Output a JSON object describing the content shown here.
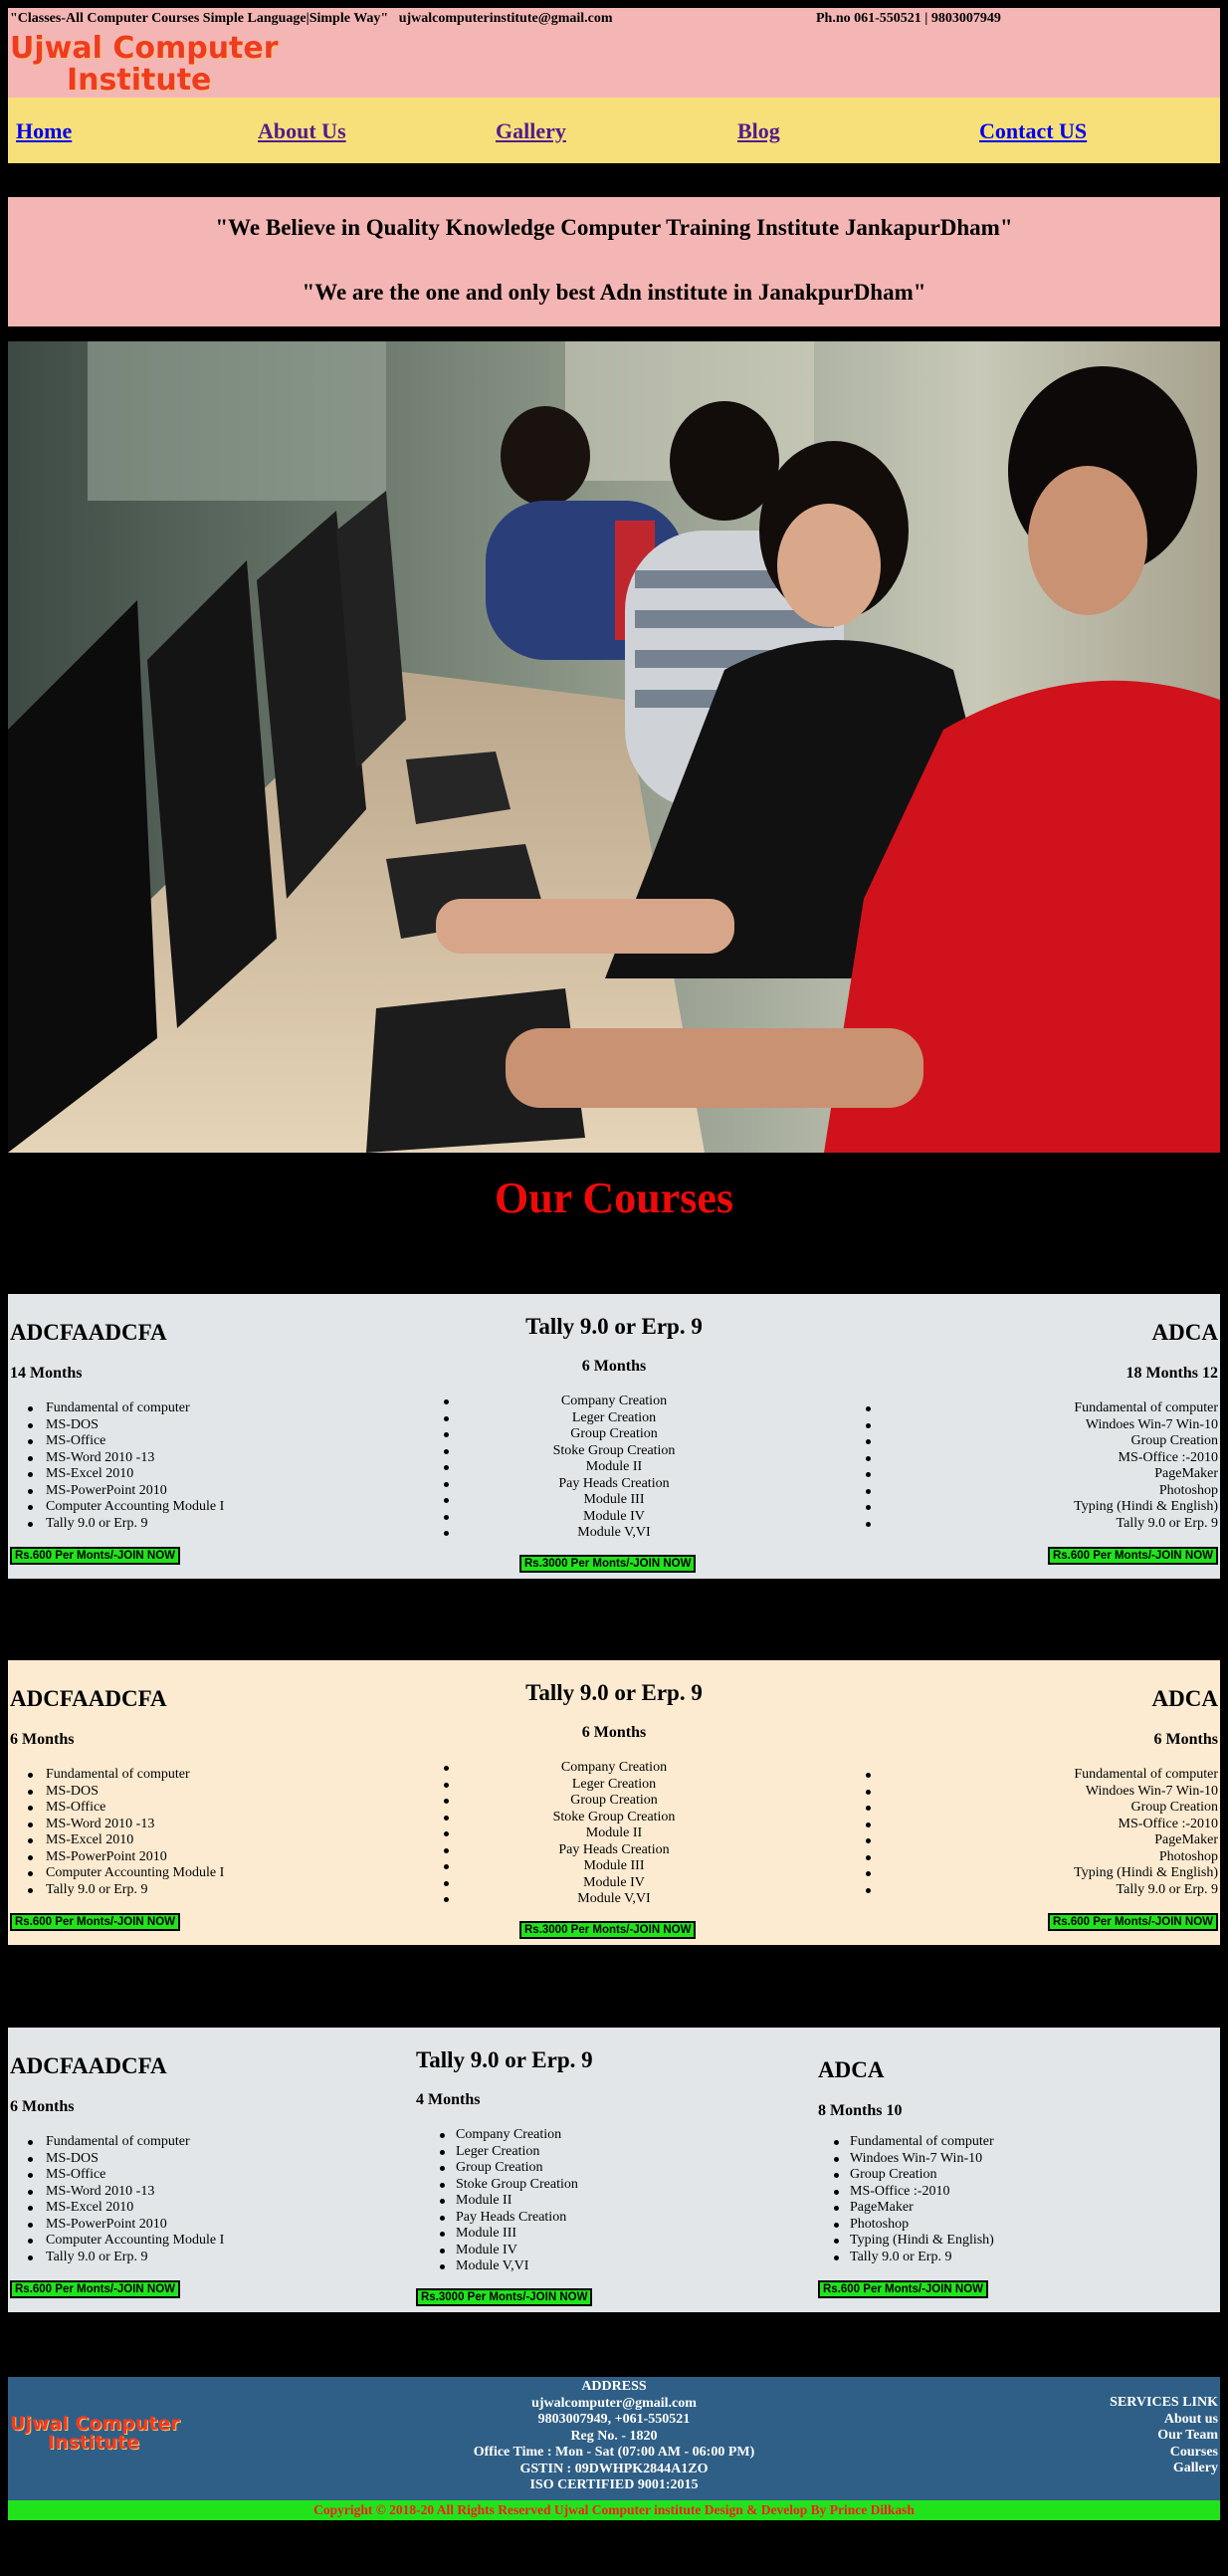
{
  "header": {
    "tagline": "\"Classes-All Computer Courses Simple Language|Simple Way\"",
    "email": "ujwalcomputerinstitute@gmail.com",
    "phone": "Ph.no 061-550521 | 9803007949",
    "logo_line1": "Ujwal Computer",
    "logo_line2": "Institute"
  },
  "nav": {
    "items": [
      {
        "label": "Home"
      },
      {
        "label": "About Us"
      },
      {
        "label": "Gallery"
      },
      {
        "label": "Blog"
      },
      {
        "label": "Contact US"
      }
    ]
  },
  "quotes": {
    "line1": "\"We Believe in Quality Knowledge Computer Training Institute JankapurDham\"",
    "line2": "\"We are the one and only best Adn institute in JanakpurDham\""
  },
  "hero": {
    "image_alt": "Students typing at computers in a classroom"
  },
  "courses_heading": "Our Courses",
  "course_rows": [
    {
      "col1": {
        "title": "ADCFAADCFA",
        "duration": "14 Months",
        "items": [
          "Fundamental of computer",
          "MS-DOS",
          "MS-Office",
          "MS-Word 2010 -13",
          "MS-Excel 2010",
          "MS-PowerPoint 2010",
          "Computer Accounting Module I",
          "Tally 9.0 or Erp. 9"
        ],
        "button": "Rs.600 Per Monts/-JOIN NOW"
      },
      "col2": {
        "title": "Tally 9.0 or Erp. 9",
        "duration": "6 Months",
        "items": [
          "Company Creation",
          "Leger Creation",
          "Group Creation",
          "Stoke Group Creation",
          "Module II",
          "Pay Heads Creation",
          "Module III",
          "Module IV",
          "Module V,VI"
        ],
        "button": "Rs.3000 Per Monts/-JOIN NOW"
      },
      "col3": {
        "title": "ADCA",
        "duration": "18 Months 12",
        "items": [
          "Fundamental of computer",
          "Windoes Win-7 Win-10",
          "Group Creation",
          "MS-Office :-2010",
          "PageMaker",
          "Photoshop",
          "Typing (Hindi & English)",
          "Tally 9.0 or Erp. 9"
        ],
        "button": "Rs.600 Per Monts/-JOIN NOW"
      }
    },
    {
      "col1": {
        "title": "ADCFAADCFA",
        "duration": "6 Months",
        "items": [
          "Fundamental of computer",
          "MS-DOS",
          "MS-Office",
          "MS-Word 2010 -13",
          "MS-Excel 2010",
          "MS-PowerPoint 2010",
          "Computer Accounting Module I",
          "Tally 9.0 or Erp. 9"
        ],
        "button": "Rs.600 Per Monts/-JOIN NOW"
      },
      "col2": {
        "title": "Tally 9.0 or Erp. 9",
        "duration": "6 Months",
        "items": [
          "Company Creation",
          "Leger Creation",
          "Group Creation",
          "Stoke Group Creation",
          "Module II",
          "Pay Heads Creation",
          "Module III",
          "Module IV",
          "Module V,VI"
        ],
        "button": "Rs.3000 Per Monts/-JOIN NOW"
      },
      "col3": {
        "title": "ADCA",
        "duration": "6 Months",
        "items": [
          "Fundamental of computer",
          "Windoes Win-7 Win-10",
          "Group Creation",
          "MS-Office :-2010",
          "PageMaker",
          "Photoshop",
          "Typing (Hindi & English)",
          "Tally 9.0 or Erp. 9"
        ],
        "button": "Rs.600 Per Monts/-JOIN NOW"
      }
    },
    {
      "col1": {
        "title": "ADCFAADCFA",
        "duration": "6 Months",
        "items": [
          "Fundamental of computer",
          "MS-DOS",
          "MS-Office",
          "MS-Word 2010 -13",
          "MS-Excel 2010",
          "MS-PowerPoint 2010",
          "Computer Accounting Module I",
          "Tally 9.0 or Erp. 9"
        ],
        "button": "Rs.600 Per Monts/-JOIN NOW"
      },
      "col2": {
        "title": "Tally 9.0 or Erp. 9",
        "duration": "4 Months",
        "items": [
          "Company Creation",
          "Leger Creation",
          "Group Creation",
          "Stoke Group Creation",
          "Module II",
          "Pay Heads Creation",
          "Module III",
          "Module IV",
          "Module V,VI"
        ],
        "button": "Rs.3000 Per Monts/-JOIN NOW"
      },
      "col3": {
        "title": "ADCA",
        "duration": "8 Months 10",
        "items": [
          "Fundamental of computer",
          "Windoes Win-7 Win-10",
          "Group Creation",
          "MS-Office :-2010",
          "PageMaker",
          "Photoshop",
          "Typing (Hindi & English)",
          "Tally 9.0 or Erp. 9"
        ],
        "button": "Rs.600 Per Monts/-JOIN NOW"
      }
    }
  ],
  "footer": {
    "logo_line1": "Ujwal Computer",
    "logo_line2": "Institute",
    "address_lines": [
      "ADDRESS",
      "ujwalcomputer@gmail.com",
      "9803007949, +061-550521",
      "Reg No. - 1820",
      "Office Time : Mon - Sat (07:00 AM - 06:00 PM)",
      "GSTIN : 09DWHPK2844A1ZO",
      "ISO CERTIFIED 9001:2015"
    ],
    "services_title": "SERVICES LINK",
    "services": [
      "About us",
      "Our Team",
      "Courses",
      "Gallery"
    ],
    "copyright": "Copyright © 2018-20 All Rights Reserved Ujwal Computer institute Design & Develop By Prince Dilkash"
  },
  "colors": {
    "header_bg": "#f4b6b4",
    "nav_bg": "#f7e07a",
    "heading_red": "#ee0a0a",
    "button_green": "#21e31c",
    "footer_blue": "#2f5f86"
  }
}
